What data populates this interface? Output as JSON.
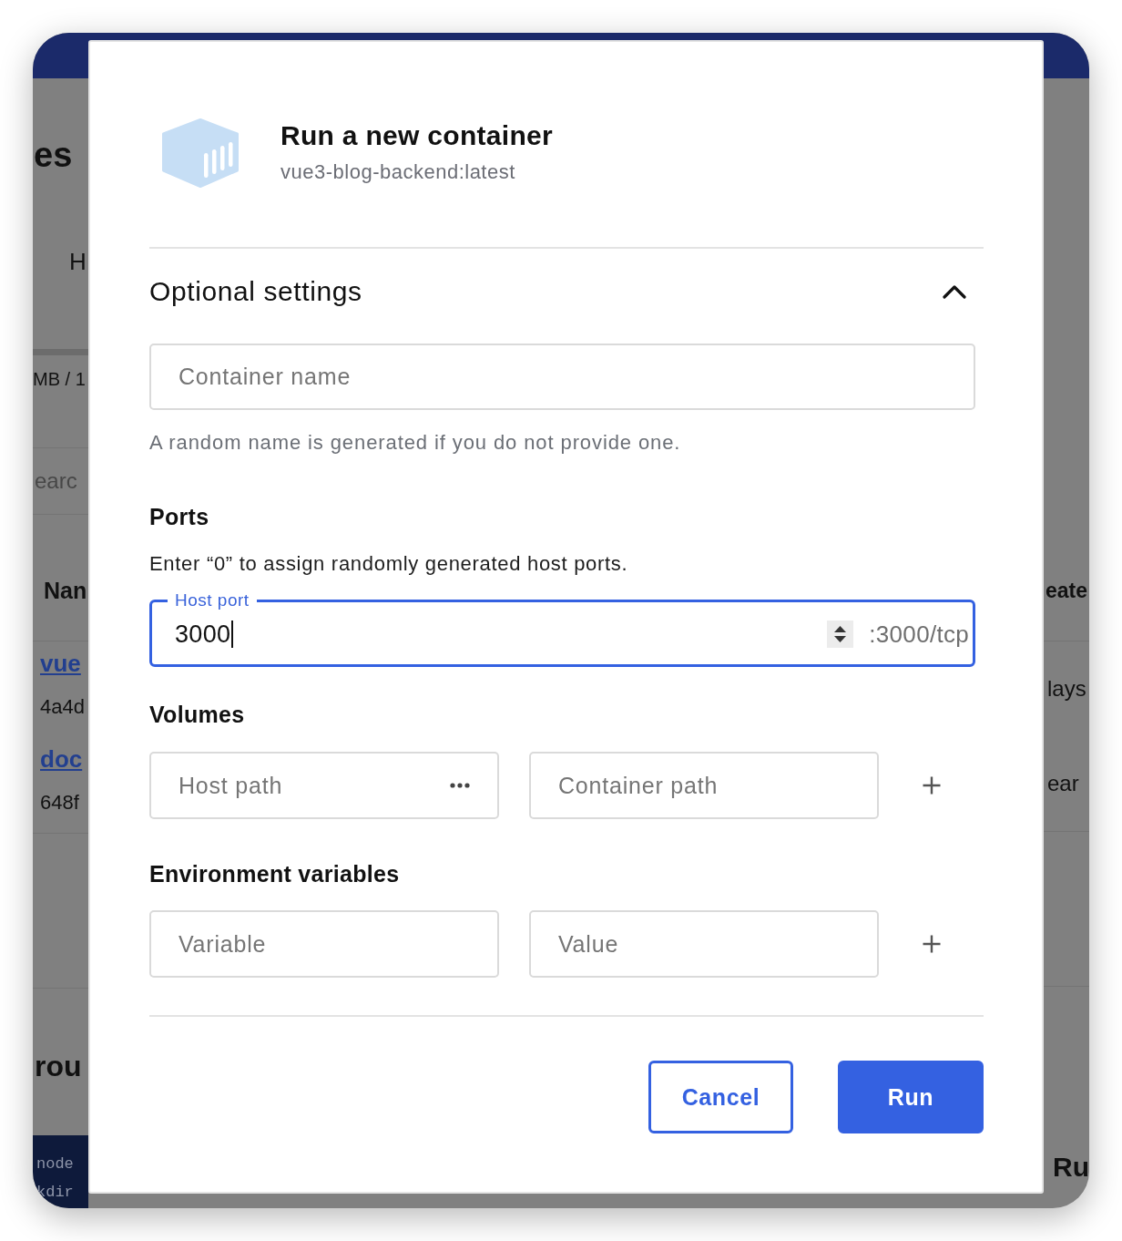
{
  "app_background": {
    "left": [
      {
        "kind": "page-title",
        "text": "es"
      },
      {
        "kind": "tab",
        "text": "H"
      },
      {
        "kind": "usage",
        "text": "MB / 1"
      },
      {
        "kind": "search",
        "text": "earc"
      },
      {
        "kind": "column-header",
        "text": "Nan"
      },
      {
        "kind": "link",
        "text": "vue"
      },
      {
        "kind": "id",
        "text": "4a4d"
      },
      {
        "kind": "link",
        "text": "doc"
      },
      {
        "kind": "id",
        "text": "648f"
      },
      {
        "kind": "section-title",
        "text": "rou"
      },
      {
        "kind": "code",
        "text": "node"
      },
      {
        "kind": "code",
        "text": "kdir"
      }
    ],
    "right": [
      {
        "kind": "column-header",
        "text": "eate"
      },
      {
        "kind": "cell",
        "text": "lays"
      },
      {
        "kind": "cell",
        "text": "ear"
      },
      {
        "kind": "heading",
        "text": "Ru"
      }
    ]
  },
  "dialog": {
    "title": "Run a new container",
    "subtitle": "vue3-blog-backend:latest",
    "optional_settings": {
      "title": "Optional settings",
      "expanded": true,
      "container_name": {
        "placeholder": "Container name",
        "hint": "A random name is generated if you do not provide one."
      },
      "ports": {
        "title": "Ports",
        "description": "Enter “0” to assign randomly generated host ports.",
        "host_port": {
          "label": "Host port",
          "value": "3000",
          "focused": true,
          "suffix": ":3000/tcp"
        }
      },
      "volumes": {
        "title": "Volumes",
        "fields": [
          {
            "kind": "browse",
            "placeholder": "Host path"
          },
          {
            "kind": "text",
            "placeholder": "Container path"
          }
        ]
      },
      "environment_variables": {
        "title": "Environment variables",
        "fields": [
          {
            "kind": "text",
            "placeholder": "Variable"
          },
          {
            "kind": "text",
            "placeholder": "Value"
          }
        ]
      }
    },
    "buttons": [
      {
        "kind": "secondary",
        "label": "Cancel"
      },
      {
        "kind": "primary",
        "label": "Run"
      }
    ]
  }
}
